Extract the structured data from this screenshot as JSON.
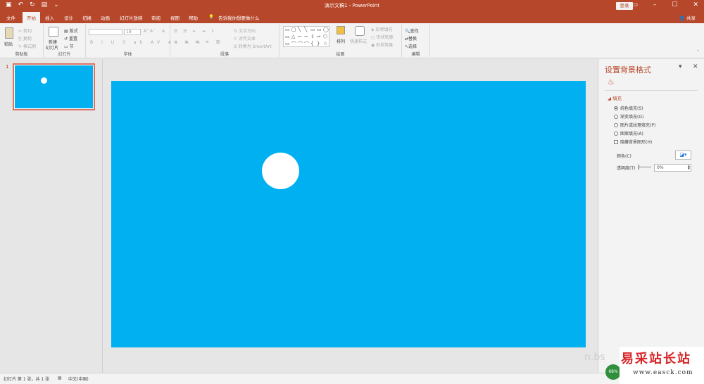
{
  "titlebar": {
    "title": "演示文稿1  -  PowerPoint",
    "login": "登录"
  },
  "tabs": [
    "文件",
    "开始",
    "插入",
    "设计",
    "切换",
    "动画",
    "幻灯片放映",
    "审阅",
    "视图",
    "帮助"
  ],
  "tell_me": "告诉我你想要做什么",
  "share": "共享",
  "ribbon": {
    "clipboard": {
      "paste": "粘贴",
      "cut": "剪切",
      "copy": "复制",
      "format_painter": "格式刷",
      "label": "剪贴板"
    },
    "slides": {
      "new_slide": "新建",
      "new_slide2": "幻灯片",
      "layout": "版式",
      "reset": "重置",
      "section": "节",
      "label": "幻灯片"
    },
    "font": {
      "size": "18",
      "label": "字体"
    },
    "paragraph": {
      "text_direction": "文字方向",
      "align_text": "对齐文本",
      "smartart": "转换为 SmartArt",
      "label": "段落"
    },
    "drawing": {
      "arrange": "排列",
      "quick_styles": "快速样式",
      "fill": "形状填充",
      "outline": "形状轮廓",
      "effects": "形状效果",
      "label": "绘图"
    },
    "editing": {
      "find": "查找",
      "replace": "替换",
      "select": "选择",
      "label": "编辑"
    }
  },
  "thumbnail": {
    "number": "1"
  },
  "format_pane": {
    "title": "设置背景格式",
    "section": "填充",
    "options": [
      "纯色填充(S)",
      "渐变填充(G)",
      "图片或纹理填充(P)",
      "图案填充(A)"
    ],
    "hide_bg": "隐藏背景图形(H)",
    "color_label": "颜色(C)",
    "transparency_label": "透明度(T)",
    "transparency_value": "0%"
  },
  "status": {
    "slide_info": "幻灯片 第 1 张，共 1 张",
    "language": "中文(中国)"
  },
  "watermark": {
    "cn": "易采站长站",
    "url": "www.easck.com",
    "badge": "68%"
  },
  "colors": {
    "accent": "#b7472a",
    "slide_bg": "#00b0f0",
    "circle": "#ffffff"
  }
}
